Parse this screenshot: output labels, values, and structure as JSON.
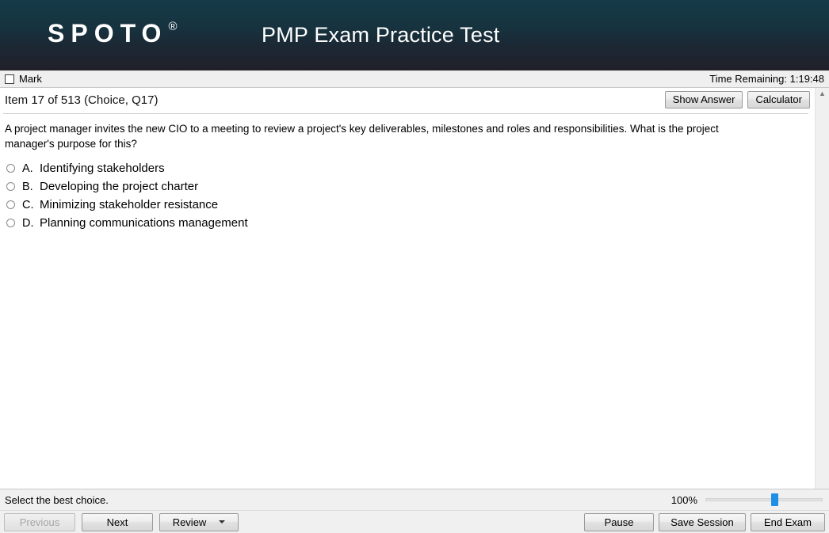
{
  "header": {
    "logo_text": "SPOTO",
    "logo_registered": "®",
    "title": "PMP Exam Practice Test"
  },
  "markbar": {
    "mark_label": "Mark",
    "timer_text": "Time Remaining: 1:19:48"
  },
  "item": {
    "label": "Item 17 of 513 (Choice, Q17)",
    "show_answer_label": "Show Answer",
    "calculator_label": "Calculator",
    "question": "A project manager invites the new CIO to a meeting to review a project's key deliverables, milestones and roles and responsibilities. What is the project manager's purpose for this?",
    "options": [
      {
        "letter": "A.",
        "text": "Identifying stakeholders",
        "selected": false
      },
      {
        "letter": "B.",
        "text": "Developing the project charter",
        "selected": false
      },
      {
        "letter": "C.",
        "text": "Minimizing stakeholder resistance",
        "selected": false
      },
      {
        "letter": "D.",
        "text": "Planning communications management",
        "selected": false
      }
    ]
  },
  "status": {
    "instruction": "Select the best choice.",
    "zoom_percent": "100%"
  },
  "nav": {
    "previous_label": "Previous",
    "next_label": "Next",
    "review_label": "Review",
    "pause_label": "Pause",
    "save_session_label": "Save Session",
    "end_exam_label": "End Exam"
  },
  "colors": {
    "header_top": "#143a48",
    "header_bottom": "#212029",
    "slider_thumb": "#1f8fe3",
    "panel": "#f0f0f0"
  }
}
